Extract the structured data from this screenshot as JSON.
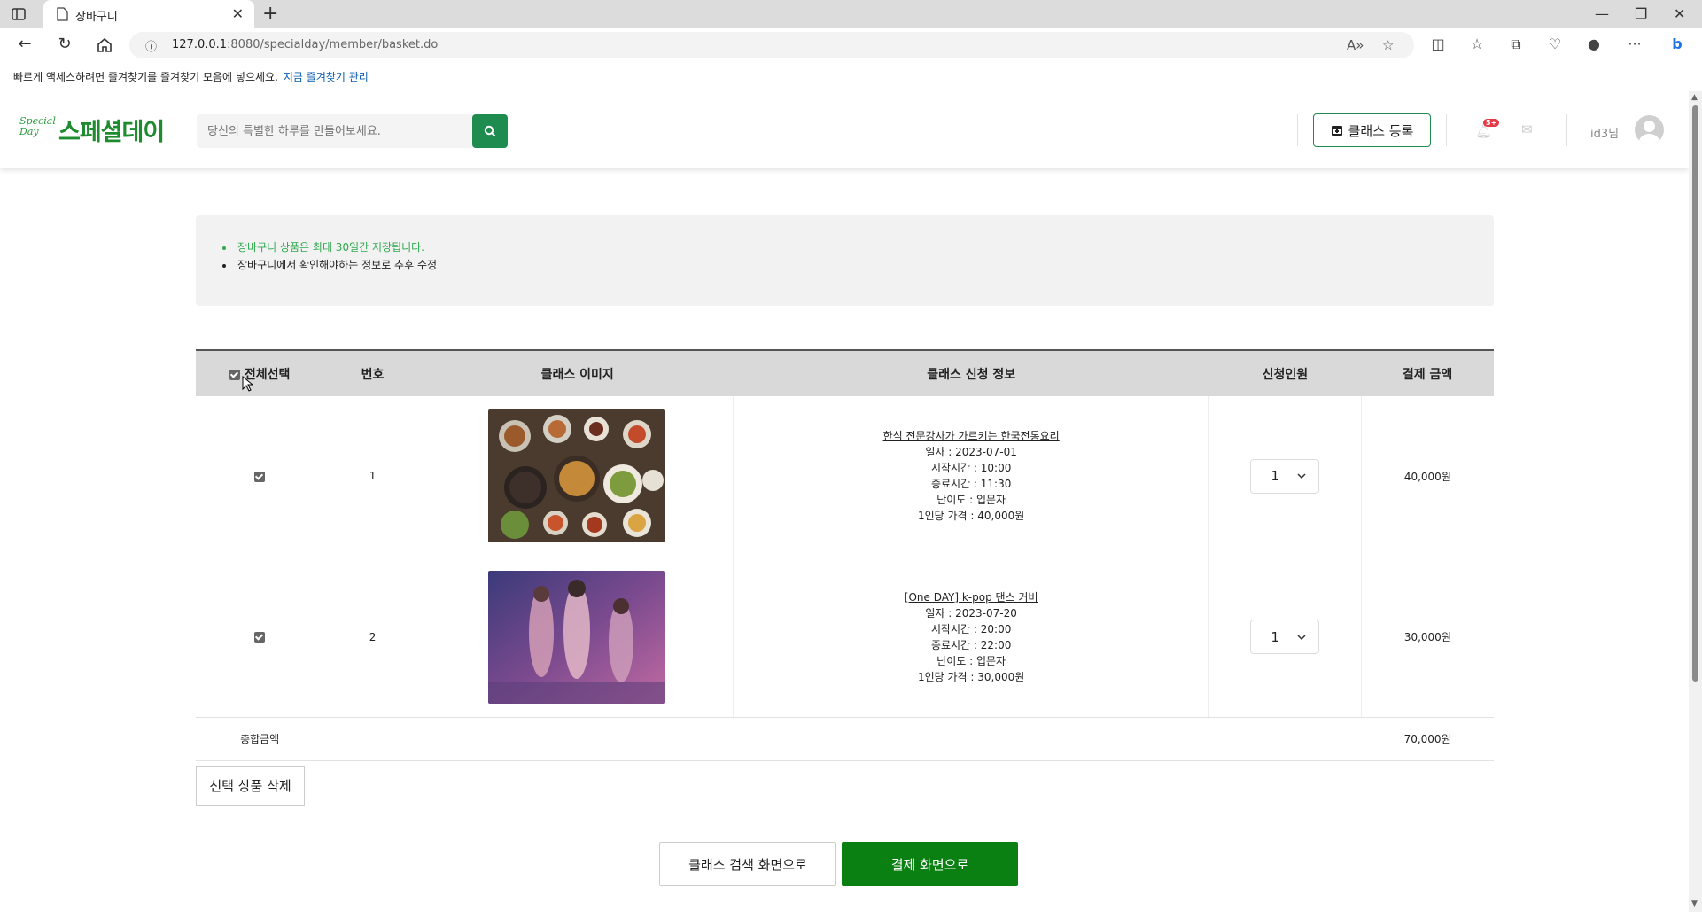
{
  "browser": {
    "tab_title": "장바구니",
    "url_host": "127.0.0.1",
    "url_rest": ":8080/specialday/member/basket.do",
    "favorites_prompt": "빠르게 액세스하려면 즐겨찾기를 즐겨찾기 모음에 넣으세요.",
    "favorites_link": "지금 즐겨찾기 관리"
  },
  "header": {
    "logo_text": "스페셜데이",
    "logo_emblem": "Special Day",
    "search_placeholder": "당신의 특별한 하루를 만들어보세요.",
    "class_register_label": "클래스 등록",
    "notification_badge": "5+",
    "user_name": "id3님"
  },
  "notice": {
    "items": [
      "장바구니 상품은 최대 30일간 저장됩니다.",
      "장바구니에서 확인해야하는 정보로 추후 수정"
    ]
  },
  "table": {
    "headers": {
      "select_all": "전체선택",
      "number": "번호",
      "image": "클래스 이미지",
      "info": "클래스 신청 정보",
      "people": "신청인원",
      "amount": "결제 금액"
    },
    "rows": [
      {
        "no": "1",
        "class_name": "한식 전문강사가 가르키는 한국전통요리",
        "date": "일자 : 2023-07-01",
        "start": "시작시간 : 10:00",
        "end": "종료시간 : 11:30",
        "level": "난이도 : 입문자",
        "price": "1인당 가격 : 40,000원",
        "qty": "1",
        "amount": "40,000원",
        "checked": true
      },
      {
        "no": "2",
        "class_name": "[One DAY] k-pop 댄스 커버",
        "date": "일자 : 2023-07-20",
        "start": "시작시간 : 20:00",
        "end": "종료시간 : 22:00",
        "level": "난이도 : 입문자",
        "price": "1인당 가격 : 30,000원",
        "qty": "1",
        "amount": "30,000원",
        "checked": true
      }
    ],
    "total_label": "총합금액",
    "total_amount": "70,000원"
  },
  "buttons": {
    "delete_selected": "선택 상품 삭제",
    "to_search": "클래스 검색 화면으로",
    "to_payment": "결제 화면으로"
  },
  "colors": {
    "brand_green": "#1e8b2f",
    "pay_button": "#0a7f12",
    "notice_green": "#2fa84f"
  }
}
